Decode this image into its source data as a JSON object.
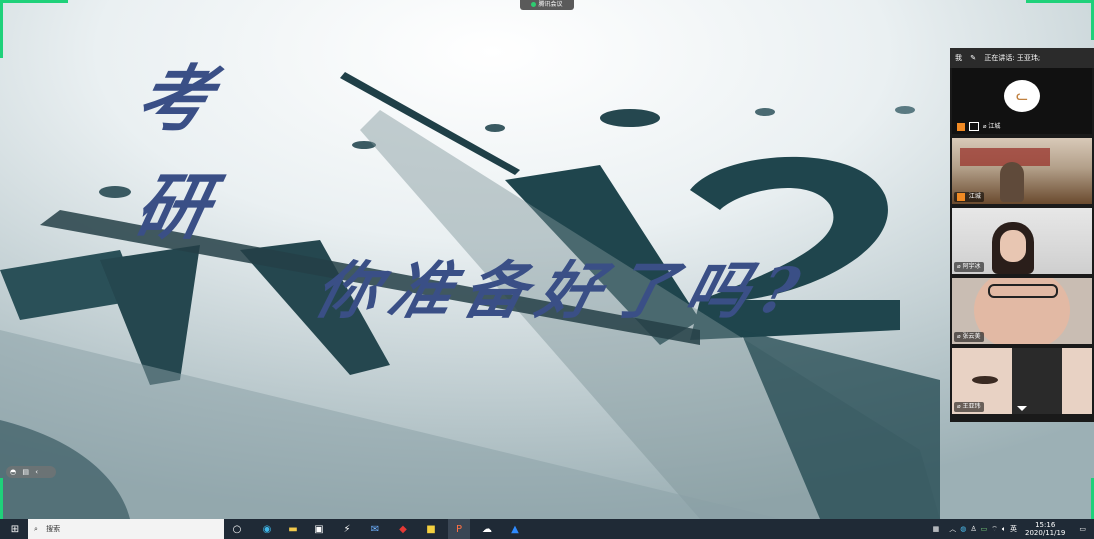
{
  "meeting_app": {
    "name": "腾讯会议"
  },
  "slide": {
    "title_char_1": "考",
    "title_char_2": "研",
    "slogan": "你准备好了吗?"
  },
  "participants_panel": {
    "me_label": "我",
    "speaking_label": "正在讲话: 王亚玮;",
    "participants": [
      {
        "name": "江城"
      },
      {
        "name": "江城"
      },
      {
        "name": "阿宇冰"
      },
      {
        "name": "张云美"
      },
      {
        "name": "王亚玮"
      }
    ]
  },
  "taskbar": {
    "search_placeholder": "搜索",
    "ime": "英",
    "time": "15:16",
    "date": "2020/11/19"
  },
  "colors": {
    "slide_text": "#3a4f86",
    "accent_green": "#1fd17a",
    "taskbar": "#1f2a36"
  }
}
